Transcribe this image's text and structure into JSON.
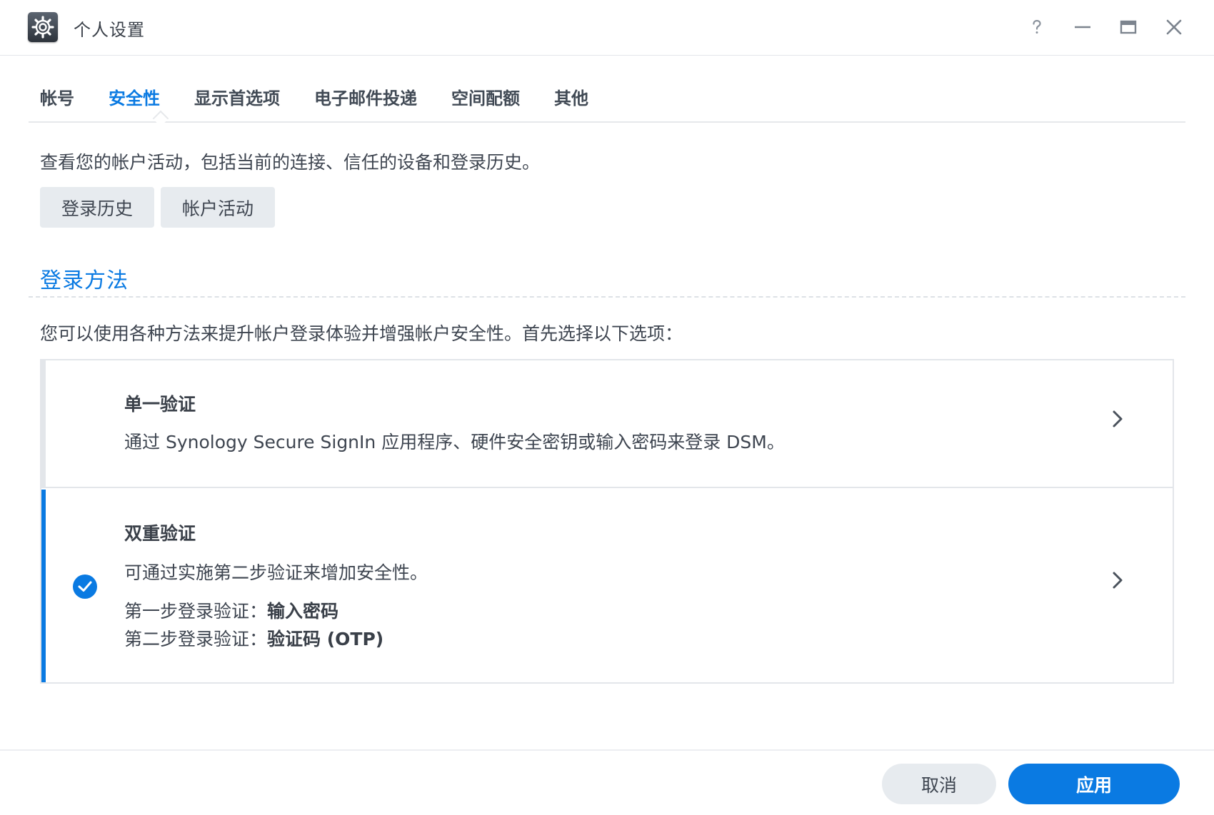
{
  "window": {
    "title": "个人设置",
    "app_icon": "gear-icon",
    "controls": [
      "help-icon",
      "minimize-icon",
      "maximize-icon",
      "close-icon"
    ],
    "help_glyph": "?"
  },
  "tabs": [
    {
      "label": "帐号",
      "active": false
    },
    {
      "label": "安全性",
      "active": true
    },
    {
      "label": "显示首选项",
      "active": false
    },
    {
      "label": "电子邮件投递",
      "active": false
    },
    {
      "label": "空间配额",
      "active": false
    },
    {
      "label": "其他",
      "active": false
    }
  ],
  "security": {
    "description": "查看您的帐户活动，包括当前的连接、信任的设备和登录历史。",
    "buttons": {
      "login_history": "登录历史",
      "account_activity": "帐户活动"
    },
    "login_methods": {
      "title": "登录方法",
      "intro": "您可以使用各种方法来提升帐户登录体验并增强帐户安全性。首先选择以下选项：",
      "options": [
        {
          "title": "单一验证",
          "description": "通过 Synology Secure SignIn 应用程序、硬件安全密钥或输入密码来登录 DSM。",
          "selected": false
        },
        {
          "title": "双重验证",
          "description": "可通过实施第二步验证来增加安全性。",
          "step1_label": "第一步登录验证：",
          "step1_value": "输入密码",
          "step2_label": "第二步登录验证：",
          "step2_value": "验证码 (OTP)",
          "selected": true
        }
      ]
    }
  },
  "footer": {
    "cancel": "取消",
    "apply": "应用"
  },
  "colors": {
    "accent": "#0a7ae2",
    "text": "#3a4049",
    "button_gray": "#e7ebef",
    "border": "#e3e6ea"
  }
}
